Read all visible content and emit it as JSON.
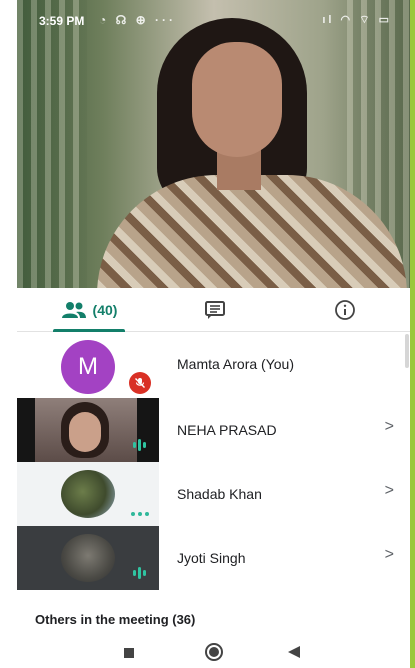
{
  "status_bar": {
    "time": "3:59 PM",
    "left_icons": "◔ ☊ ⊕ ···",
    "right_icons": "ıl ◠ ⌔ ▭"
  },
  "tabs": [
    {
      "icon": "people-icon",
      "count": "(40)"
    },
    {
      "icon": "chat-icon"
    },
    {
      "icon": "info-icon"
    }
  ],
  "participants": [
    {
      "name": "Mamta Arora (You)",
      "avatar_letter": "M",
      "status": "muted"
    },
    {
      "name": "NEHA PRASAD",
      "status": "speaking"
    },
    {
      "name": "Shadab Khan",
      "status": "idle"
    },
    {
      "name": "Jyoti Singh",
      "status": "speaking"
    }
  ],
  "others_label": "Others in the meeting (36)",
  "colors": {
    "accent": "#137f6a",
    "avatar": "#a342c3",
    "muted": "#d93025",
    "audio": "#2fc4a1",
    "edge": "#9bc83c"
  },
  "nav_icons": [
    "recents-icon",
    "home-icon",
    "back-icon"
  ]
}
